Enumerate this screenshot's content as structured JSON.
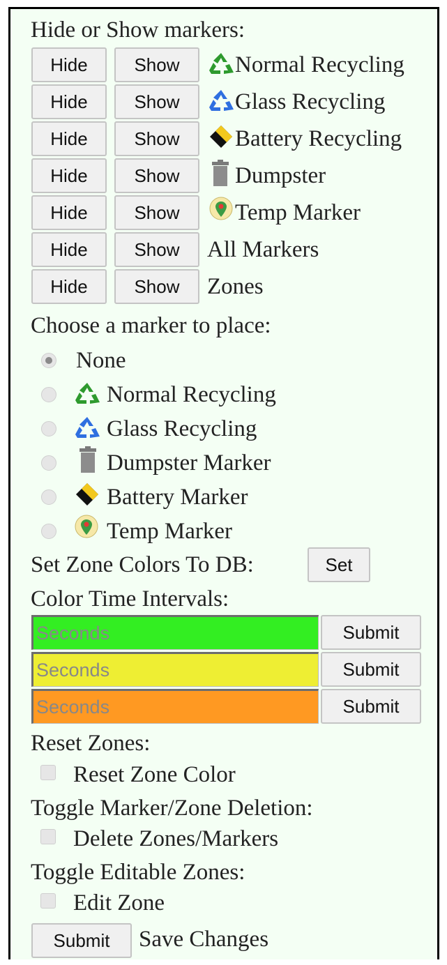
{
  "hide_show": {
    "heading": "Hide or Show markers:",
    "hide_label": "Hide",
    "show_label": "Show",
    "rows": [
      {
        "label": "Normal Recycling",
        "icon": "recycle-green-icon"
      },
      {
        "label": "Glass Recycling",
        "icon": "recycle-blue-icon"
      },
      {
        "label": "Battery Recycling",
        "icon": "battery-icon"
      },
      {
        "label": "Dumpster",
        "icon": "trash-icon"
      },
      {
        "label": "Temp Marker",
        "icon": "map-pin-icon"
      },
      {
        "label": "All Markers",
        "icon": ""
      },
      {
        "label": "Zones",
        "icon": ""
      }
    ]
  },
  "place": {
    "heading": "Choose a marker to place:",
    "options": [
      {
        "label": "None",
        "selected": true
      },
      {
        "label": "Normal Recycling",
        "selected": false
      },
      {
        "label": "Glass Recycling",
        "selected": false
      },
      {
        "label": "Dumpster Marker",
        "selected": false
      },
      {
        "label": "Battery Marker",
        "selected": false
      },
      {
        "label": "Temp Marker",
        "selected": false
      }
    ]
  },
  "zone_colors": {
    "label": "Set Zone Colors To DB:",
    "button": "Set"
  },
  "intervals": {
    "heading": "Color Time Intervals:",
    "placeholder": "Seconds",
    "submit": "Submit",
    "colors": [
      "#33ee22",
      "#eeee33",
      "#ff9922"
    ]
  },
  "reset": {
    "heading": "Reset Zones:",
    "checkbox": "Reset Zone Color"
  },
  "deletion": {
    "heading": "Toggle Marker/Zone Deletion:",
    "checkbox": "Delete Zones/Markers"
  },
  "editable": {
    "heading": "Toggle Editable Zones:",
    "checkbox": "Edit Zone"
  },
  "footer": {
    "submit": "Submit",
    "label": "Save Changes"
  }
}
